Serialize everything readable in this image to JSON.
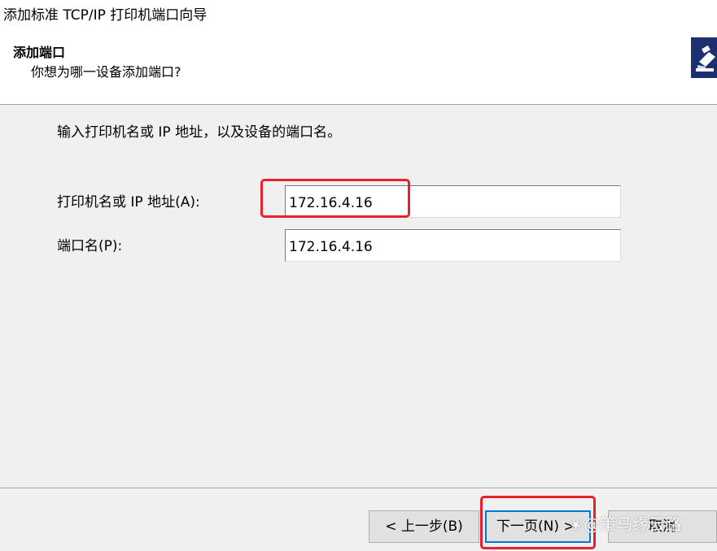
{
  "window": {
    "title": "添加标准 TCP/IP 打印机端口向导"
  },
  "header": {
    "title": "添加端口",
    "subtitle": "你想为哪一设备添加端口?",
    "icon": "printer-icon"
  },
  "content": {
    "instruction": "输入打印机名或 IP 地址，以及设备的端口名。",
    "fields": [
      {
        "label": "打印机名或 IP 地址(A):",
        "value": "172.16.4.16"
      },
      {
        "label": "端口名(P):",
        "value": "172.16.4.16"
      }
    ]
  },
  "footer": {
    "back_label": "< 上一步(B)",
    "next_label": "下一页(N) >",
    "cancel_label": "取消"
  },
  "annotations": {
    "highlight_color": "#e8202a"
  },
  "watermark": {
    "text": "@策马缘云路"
  },
  "colors": {
    "accent": "#0078d7",
    "header_bg": "#ffffff",
    "body_bg": "#f0f0f0",
    "icon_bg": "#1c2f6e"
  }
}
